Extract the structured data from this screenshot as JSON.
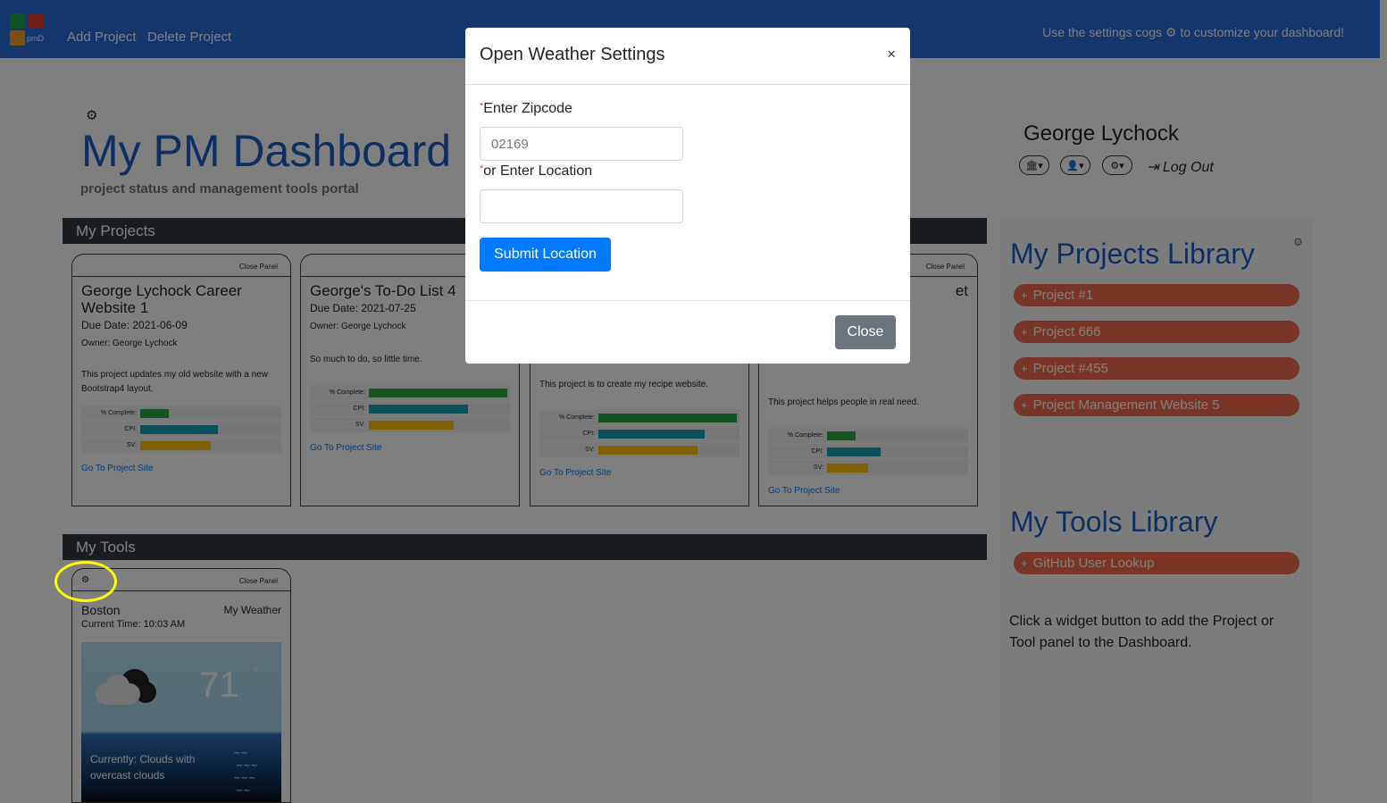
{
  "nav": {
    "logo_text": "pmD",
    "links": [
      "Add Project",
      "Delete Project"
    ],
    "hint": "Use the settings cogs ⚙ to customize your dashboard!"
  },
  "header": {
    "title": "My PM Dashboard",
    "subtitle": "project status and management tools portal"
  },
  "user": {
    "name": "George Lychock",
    "logout": "Log Out"
  },
  "projects_section": {
    "label": "My Projects",
    "close_panel": "Close Panel",
    "cards": [
      {
        "title": "George Lychock Career Website 1",
        "due": "Due Date: 2021-06-09",
        "owner": "Owner: George Lychock",
        "desc": "This project updates my old website with a new Bootstrap4 layout.",
        "metrics": [
          {
            "label": "% Complete:",
            "value": 0.2,
            "color": "#28a745"
          },
          {
            "label": "CPI:",
            "value": 0.55,
            "color": "#17a2b8"
          },
          {
            "label": "SV:",
            "value": 0.5,
            "color": "#ffc107"
          }
        ],
        "link": "Go To Project Site"
      },
      {
        "title": "George's To-Do List 4",
        "due": "Due Date: 2021-07-25",
        "owner": "Owner: George Lychock",
        "desc": "So much to do, so little time.",
        "metrics": [
          {
            "label": "% Complete:",
            "value": 0.98,
            "color": "#28a745"
          },
          {
            "label": "CPI:",
            "value": 0.7,
            "color": "#17a2b8"
          },
          {
            "label": "SV:",
            "value": 0.6,
            "color": "#ffc107"
          }
        ],
        "link": "Go To Project Site"
      },
      {
        "title": "",
        "due": "",
        "owner": "",
        "desc": "This project is to create my recipe website.",
        "metrics": [
          {
            "label": "% Complete:",
            "value": 0.98,
            "color": "#28a745"
          },
          {
            "label": "CPI:",
            "value": 0.75,
            "color": "#17a2b8"
          },
          {
            "label": "SV:",
            "value": 0.7,
            "color": "#ffc107"
          }
        ],
        "link": "Go To Project Site"
      },
      {
        "title": "et",
        "due": "",
        "owner": "",
        "desc": "This project helps people in real need.",
        "metrics": [
          {
            "label": "% Complete:",
            "value": 0.2,
            "color": "#28a745"
          },
          {
            "label": "CPI:",
            "value": 0.38,
            "color": "#17a2b8"
          },
          {
            "label": "SV:",
            "value": 0.29,
            "color": "#ffc107"
          }
        ],
        "link": "Go To Project Site"
      }
    ]
  },
  "tools_section": {
    "label": "My Tools",
    "close_panel": "Close Panel",
    "weather": {
      "city": "Boston",
      "widget_name": "My Weather",
      "current_time": "Current Time: 10:03 AM",
      "temp": "71",
      "degree": "°",
      "conditions": "Currently: Clouds with overcast clouds"
    }
  },
  "projects_library": {
    "title": "My Projects Library",
    "items": [
      "Project #1",
      "Project 666",
      "Project #455",
      "Project Management Website 5"
    ]
  },
  "tools_library": {
    "title": "My Tools Library",
    "items": [
      "GitHub User Lookup"
    ],
    "note": "Click a widget button to add the Project or Tool panel to the Dashboard."
  },
  "modal": {
    "title": "Open Weather Settings",
    "close_x": "×",
    "zip_label": "Enter Zipcode",
    "zip_placeholder": "02169",
    "location_label": "or Enter Location",
    "location_value": "",
    "submit_label": "Submit Location",
    "close_label": "Close",
    "required_mark": "*"
  }
}
